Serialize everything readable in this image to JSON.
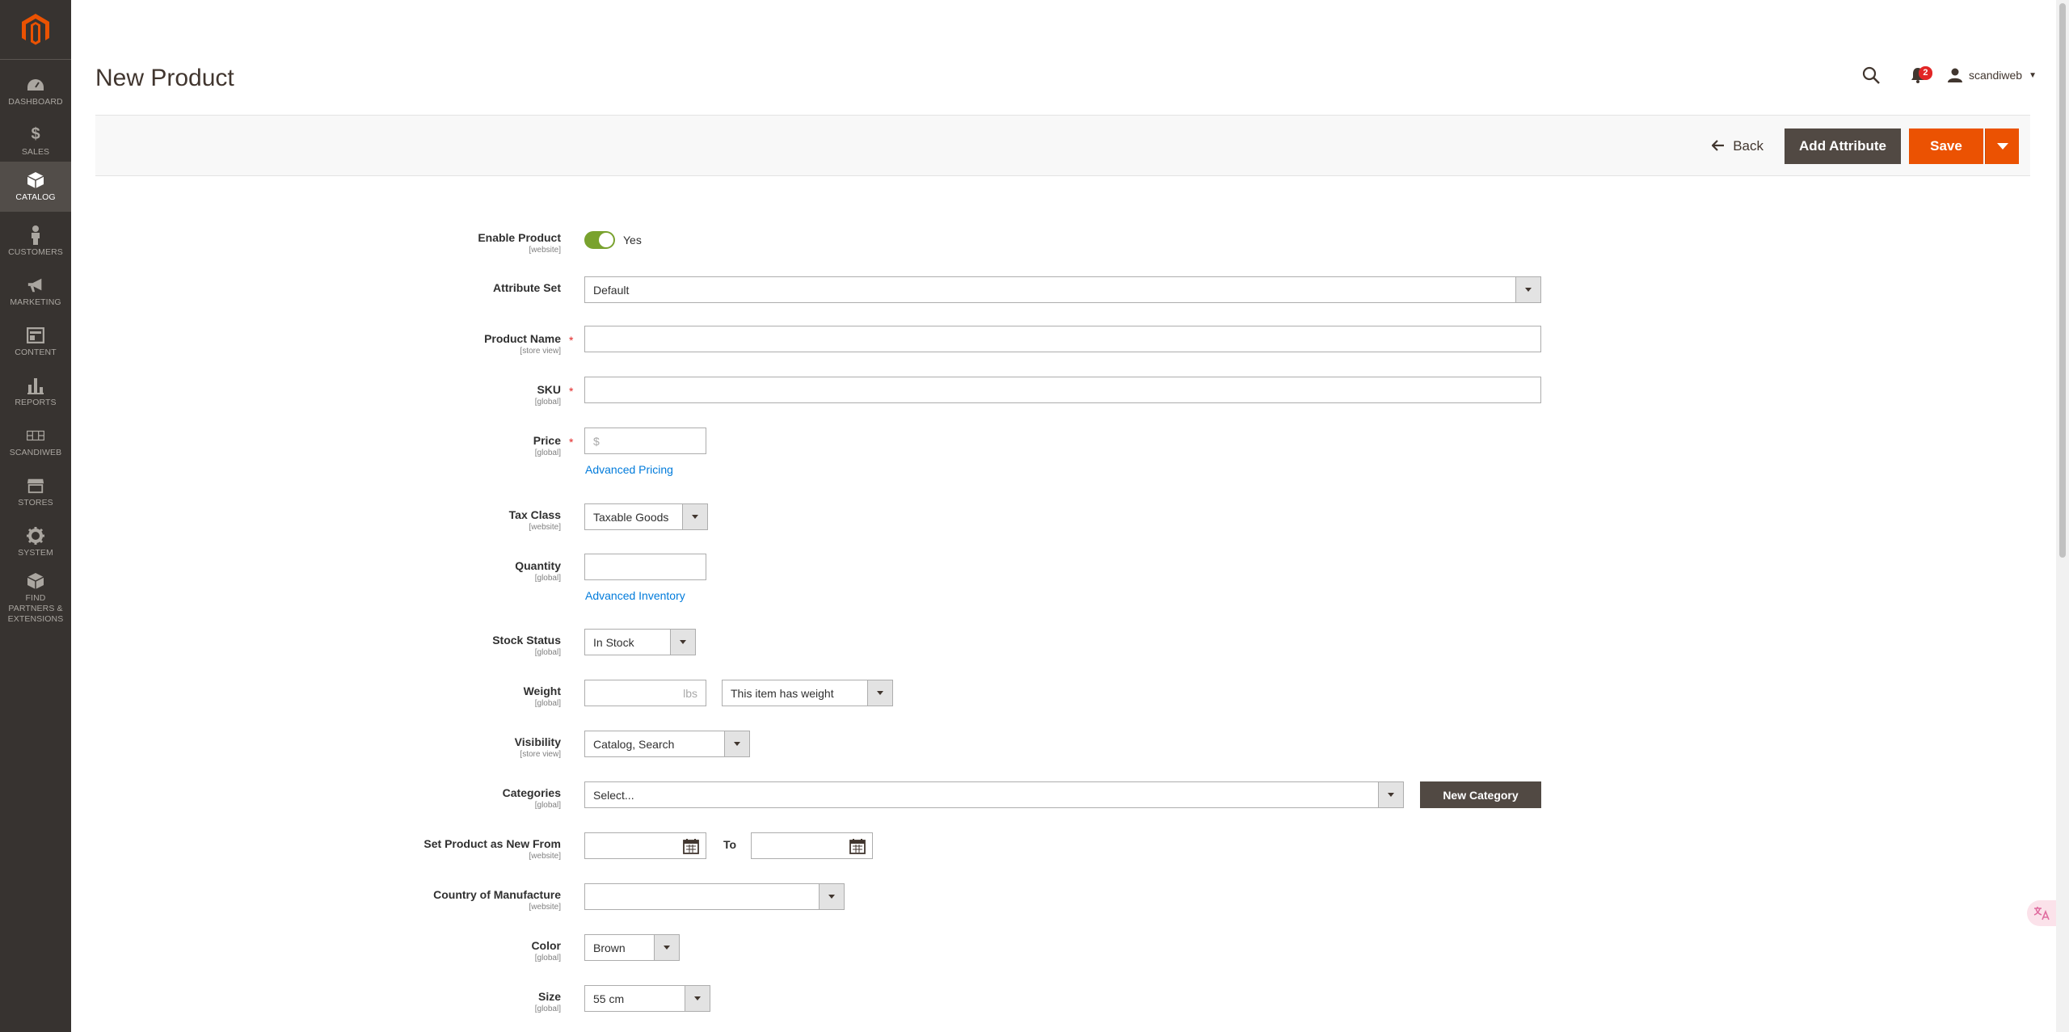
{
  "sidebar": {
    "logo": "magento-logo",
    "items": [
      {
        "label": "DASHBOARD",
        "icon": "dashboard-icon"
      },
      {
        "label": "SALES",
        "icon": "dollar-icon"
      },
      {
        "label": "CATALOG",
        "icon": "cube-icon",
        "active": true
      },
      {
        "label": "CUSTOMERS",
        "icon": "person-icon"
      },
      {
        "label": "MARKETING",
        "icon": "megaphone-icon"
      },
      {
        "label": "CONTENT",
        "icon": "layout-icon"
      },
      {
        "label": "REPORTS",
        "icon": "bar-chart-icon"
      },
      {
        "label": "SCANDIWEB",
        "icon": "grid-icon"
      },
      {
        "label": "STORES",
        "icon": "store-icon"
      },
      {
        "label": "SYSTEM",
        "icon": "gear-icon"
      },
      {
        "label": "FIND PARTNERS & EXTENSIONS",
        "icon": "box-icon"
      }
    ]
  },
  "header": {
    "title": "New Product",
    "notifications_count": "2",
    "user_name": "scandiweb"
  },
  "actions": {
    "back_label": "Back",
    "add_attribute_label": "Add Attribute",
    "save_label": "Save"
  },
  "form": {
    "enable_product": {
      "label": "Enable Product",
      "scope": "[website]",
      "value": "Yes"
    },
    "attribute_set": {
      "label": "Attribute Set",
      "value": "Default"
    },
    "product_name": {
      "label": "Product Name",
      "scope": "[store view]",
      "value": ""
    },
    "sku": {
      "label": "SKU",
      "scope": "[global]",
      "value": ""
    },
    "price": {
      "label": "Price",
      "scope": "[global]",
      "placeholder": "$",
      "link": "Advanced Pricing"
    },
    "tax_class": {
      "label": "Tax Class",
      "scope": "[website]",
      "value": "Taxable Goods"
    },
    "quantity": {
      "label": "Quantity",
      "scope": "[global]",
      "value": "",
      "link": "Advanced Inventory"
    },
    "stock_status": {
      "label": "Stock Status",
      "scope": "[global]",
      "value": "In Stock"
    },
    "weight": {
      "label": "Weight",
      "scope": "[global]",
      "unit": "lbs",
      "type_value": "This item has weight"
    },
    "visibility": {
      "label": "Visibility",
      "scope": "[store view]",
      "value": "Catalog, Search"
    },
    "categories": {
      "label": "Categories",
      "scope": "[global]",
      "value": "Select...",
      "button": "New Category"
    },
    "new_from": {
      "label": "Set Product as New From",
      "scope": "[website]",
      "to_label": "To"
    },
    "country": {
      "label": "Country of Manufacture",
      "scope": "[website]",
      "value": ""
    },
    "color": {
      "label": "Color",
      "scope": "[global]",
      "value": "Brown"
    },
    "size": {
      "label": "Size",
      "scope": "[global]",
      "value": "55 cm"
    }
  },
  "colors": {
    "sidebar_bg": "#373330",
    "accent": "#eb5202",
    "toggle_on": "#79a22e",
    "link": "#007bdb"
  }
}
